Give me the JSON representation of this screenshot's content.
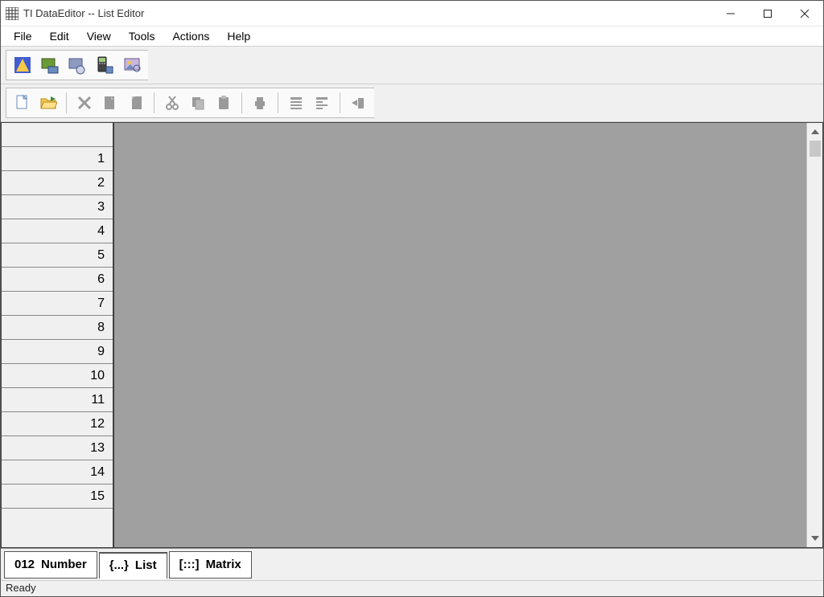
{
  "window": {
    "title": "TI DataEditor -- List Editor"
  },
  "menu": {
    "items": [
      "File",
      "Edit",
      "View",
      "Tools",
      "Actions",
      "Help"
    ]
  },
  "toolbar1": {
    "buttons": [
      "app-explorer",
      "screen-capture",
      "device-explorer",
      "calculator-link",
      "image-capture"
    ]
  },
  "toolbar2": {
    "groups": [
      [
        "new-document",
        "open-document"
      ],
      [
        "delete",
        "page-prev",
        "page-next"
      ],
      [
        "cut",
        "copy",
        "paste"
      ],
      [
        "print"
      ],
      [
        "format-left",
        "format-right"
      ],
      [
        "send"
      ]
    ]
  },
  "grid": {
    "rows": [
      "1",
      "2",
      "3",
      "4",
      "5",
      "6",
      "7",
      "8",
      "9",
      "10",
      "11",
      "12",
      "13",
      "14",
      "15"
    ]
  },
  "tabs": {
    "items": [
      {
        "key": "number",
        "label": "Number",
        "icon": "012",
        "active": false
      },
      {
        "key": "list",
        "label": "List",
        "icon": "{...}",
        "active": true
      },
      {
        "key": "matrix",
        "label": "Matrix",
        "icon": "[:::]",
        "active": false
      }
    ]
  },
  "status": {
    "text": "Ready"
  }
}
